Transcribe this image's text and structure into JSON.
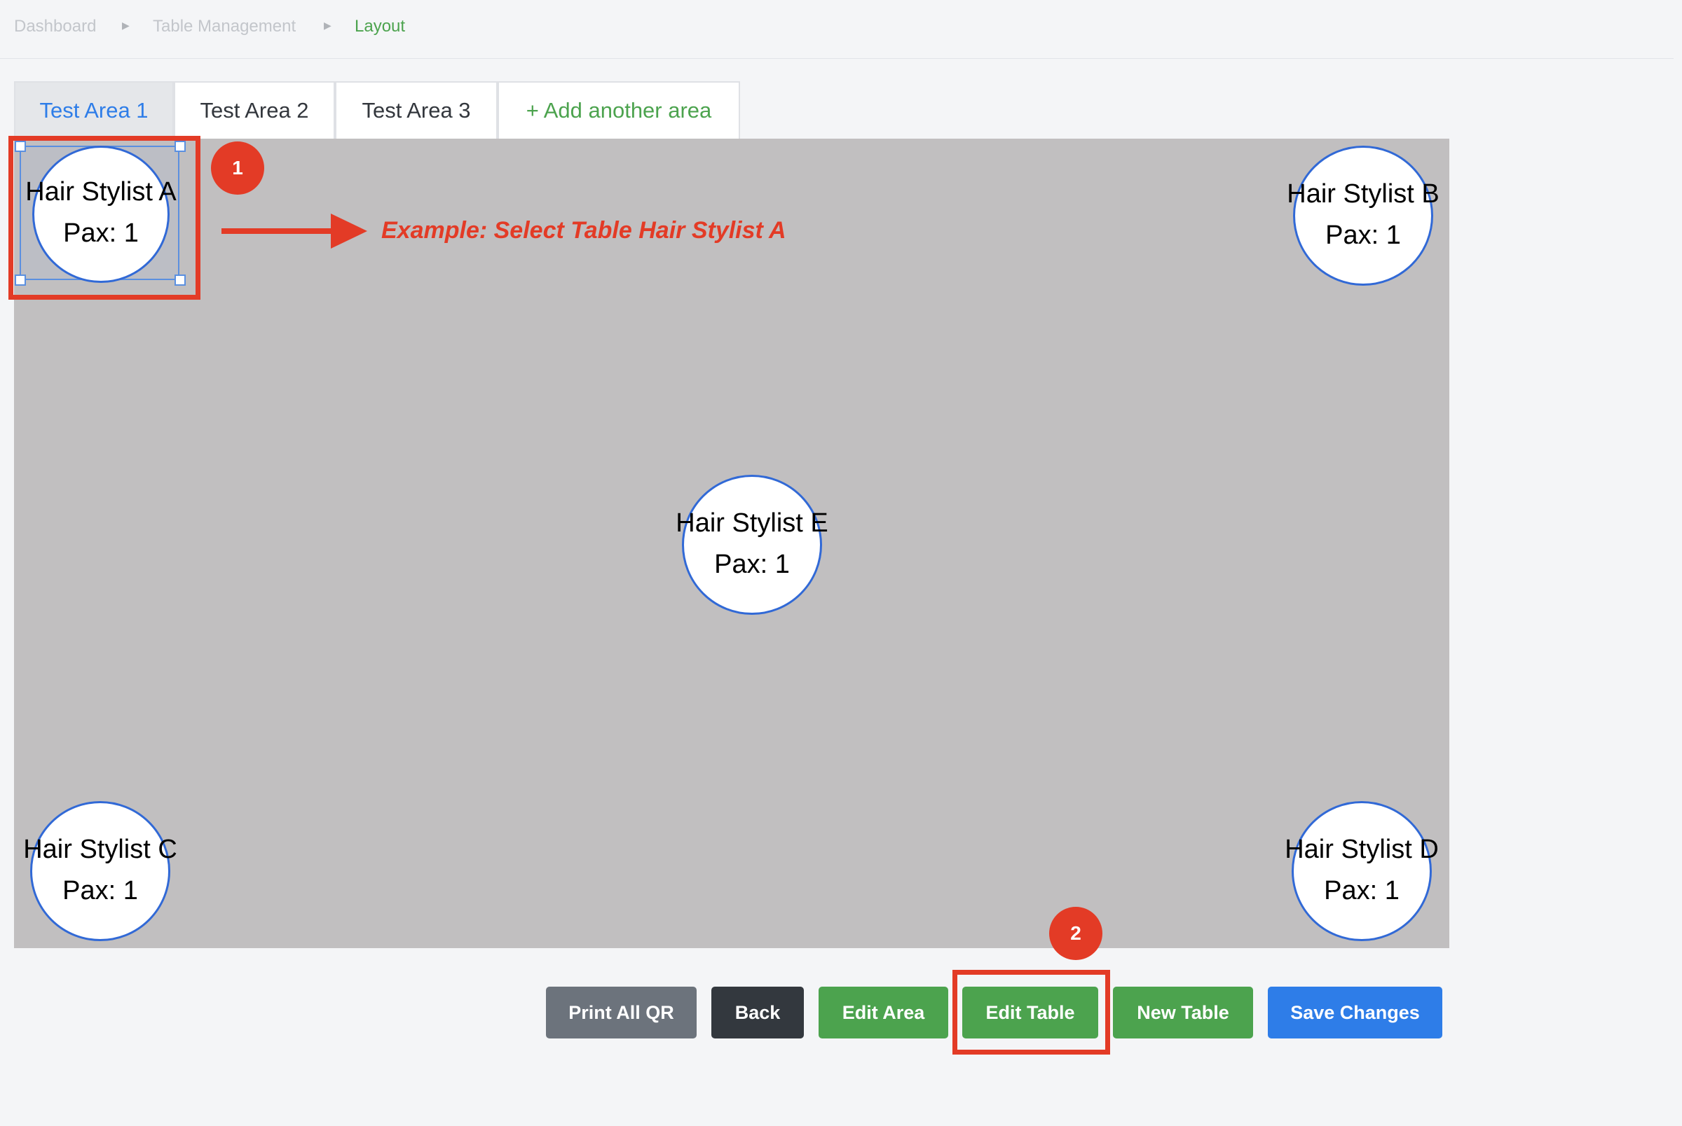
{
  "breadcrumb": {
    "items": [
      "Dashboard",
      "Table Management",
      "Layout"
    ]
  },
  "tabs": [
    "Test Area 1",
    "Test Area 2",
    "Test Area 3",
    "+ Add another area"
  ],
  "tables": [
    {
      "name": "Hair Stylist A",
      "pax": "Pax: 1"
    },
    {
      "name": "Hair Stylist B",
      "pax": "Pax: 1"
    },
    {
      "name": "Hair Stylist E",
      "pax": "Pax: 1"
    },
    {
      "name": "Hair Stylist C",
      "pax": "Pax: 1"
    },
    {
      "name": "Hair Stylist D",
      "pax": "Pax: 1"
    }
  ],
  "annotation": {
    "step1": "1",
    "step2": "2",
    "example": "Example: Select Table Hair Stylist A"
  },
  "buttons": {
    "print_all_qr": "Print All QR",
    "back": "Back",
    "edit_area": "Edit Area",
    "edit_table": "Edit Table",
    "new_table": "New Table",
    "save_changes": "Save Changes"
  },
  "colors": {
    "accent_blue": "#2e7de8",
    "green": "#4ca34e",
    "gray_button": "#6c737c",
    "dark_button": "#33383e",
    "annotation_red": "#e33b26",
    "canvas": "#c1bfc0"
  }
}
